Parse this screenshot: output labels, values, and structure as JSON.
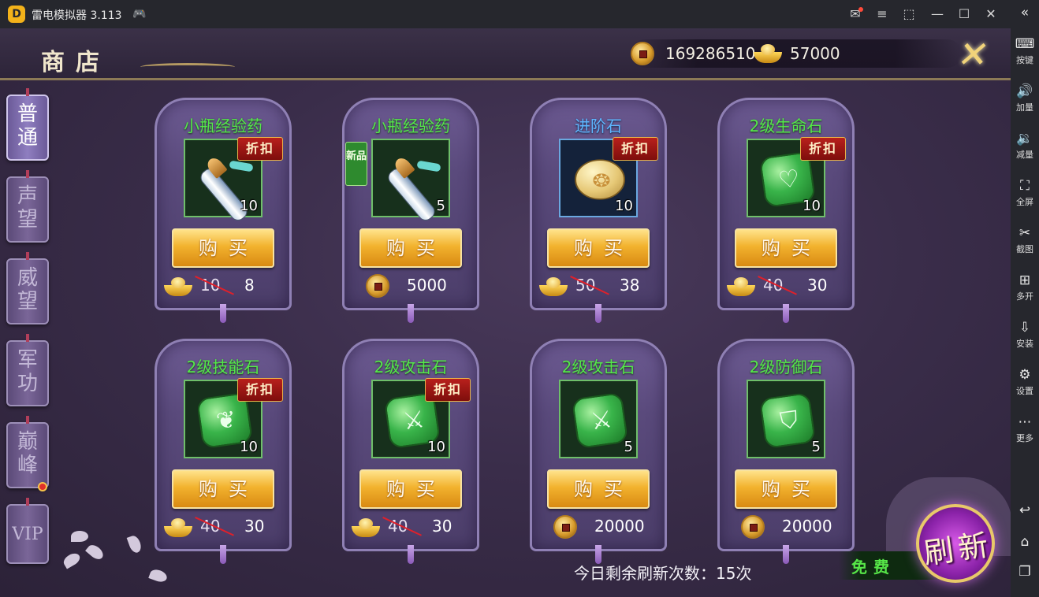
{
  "window": {
    "title": "雷电模拟器 3.113",
    "logo_glyph": "D"
  },
  "window_controls": {
    "mail": "✉",
    "menu": "≡",
    "restore_small": "⬚",
    "minimize": "—",
    "maximize": "☐",
    "close": "✕"
  },
  "side_panel": {
    "collapse": "«",
    "items": [
      {
        "icon": "⌨",
        "label": "按键"
      },
      {
        "icon": "🔊",
        "label": "加量"
      },
      {
        "icon": "🔉",
        "label": "减量"
      },
      {
        "icon": "⛶",
        "label": "全屏"
      },
      {
        "icon": "✂",
        "label": "截图"
      },
      {
        "icon": "⊞",
        "label": "多开"
      },
      {
        "icon": "⇩",
        "label": "安装"
      },
      {
        "icon": "⚙",
        "label": "设置"
      },
      {
        "icon": "⋯",
        "label": "更多"
      }
    ],
    "nav": {
      "back": "↩",
      "home": "⌂",
      "recents": "❐"
    }
  },
  "shop": {
    "title": "商店",
    "currency": {
      "coins": "169286510",
      "ingots": "57000"
    },
    "close_glyph": "✕"
  },
  "tabs": [
    {
      "label": "普通",
      "active": true
    },
    {
      "label": "声望",
      "active": false
    },
    {
      "label": "威望",
      "active": false
    },
    {
      "label": "军功",
      "active": false
    },
    {
      "label": "巅峰",
      "active": false
    },
    {
      "label": "VIP",
      "active": false
    }
  ],
  "items": [
    {
      "name": "小瓶经验药",
      "qty": "10",
      "art": "bottle",
      "discount": "折扣",
      "new": "",
      "currency": "ingot",
      "old_price": "10",
      "price": "8"
    },
    {
      "name": "小瓶经验药",
      "qty": "5",
      "art": "bottle",
      "discount": "",
      "new": "新品",
      "currency": "coin",
      "old_price": "",
      "price": "5000"
    },
    {
      "name": "进阶石",
      "qty": "10",
      "art": "stone",
      "discount": "折扣",
      "new": "",
      "currency": "ingot",
      "old_price": "50",
      "price": "38"
    },
    {
      "name": "2级生命石",
      "qty": "10",
      "art": "gem",
      "symbol": "♡",
      "discount": "折扣",
      "new": "",
      "currency": "ingot",
      "old_price": "40",
      "price": "30"
    },
    {
      "name": "2级技能石",
      "qty": "10",
      "art": "gem",
      "symbol": "❦",
      "discount": "折扣",
      "new": "",
      "currency": "ingot",
      "old_price": "40",
      "price": "30"
    },
    {
      "name": "2级攻击石",
      "qty": "10",
      "art": "gem",
      "symbol": "⚔",
      "discount": "折扣",
      "new": "",
      "currency": "ingot",
      "old_price": "40",
      "price": "30"
    },
    {
      "name": "2级攻击石",
      "qty": "5",
      "art": "gem",
      "symbol": "⚔",
      "discount": "",
      "new": "",
      "currency": "coin",
      "old_price": "",
      "price": "20000"
    },
    {
      "name": "2级防御石",
      "qty": "5",
      "art": "gem",
      "symbol": "⛉",
      "discount": "",
      "new": "",
      "currency": "coin",
      "old_price": "",
      "price": "20000"
    }
  ],
  "buy_label": "购买",
  "refresh": {
    "remaining_text": "今日剩余刷新次数：15次",
    "free_label": "免费",
    "button_glyph": "刷新"
  },
  "colors": {
    "name_green": "#55e84a",
    "name_blue": "#5fb6ff",
    "buy_gold": "#f2b22e",
    "discount_red": "#b8201c"
  }
}
